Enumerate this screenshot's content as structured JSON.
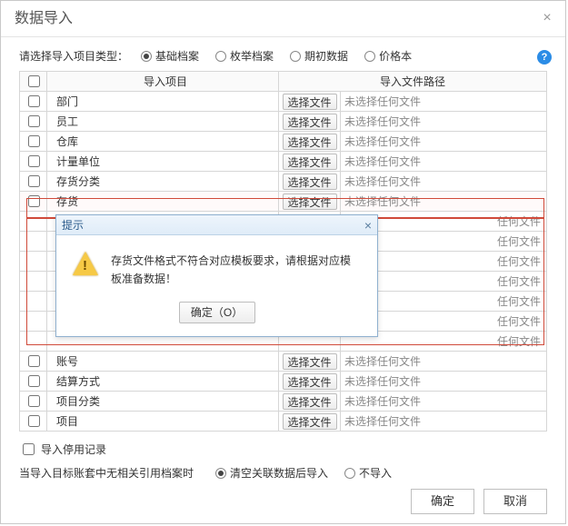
{
  "dialog": {
    "title": "数据导入",
    "type_label": "请选择导入项目类型：",
    "radios": [
      {
        "label": "基础档案",
        "checked": true
      },
      {
        "label": "枚举档案",
        "checked": false
      },
      {
        "label": "期初数据",
        "checked": false
      },
      {
        "label": "价格本",
        "checked": false
      }
    ],
    "table": {
      "head_item": "导入项目",
      "head_path": "导入文件路径",
      "file_btn": "选择文件",
      "no_file": "未选择任何文件",
      "short_file": "任何文件",
      "rows": [
        {
          "name": "部门",
          "path_kind": "full"
        },
        {
          "name": "员工",
          "path_kind": "full"
        },
        {
          "name": "仓库",
          "path_kind": "full"
        },
        {
          "name": "计量单位",
          "path_kind": "full"
        },
        {
          "name": "存货分类",
          "path_kind": "full"
        },
        {
          "name": "存货",
          "path_kind": "full",
          "highlight": true
        },
        {
          "name": "",
          "path_kind": "short"
        },
        {
          "name": "",
          "path_kind": "short"
        },
        {
          "name": "",
          "path_kind": "short"
        },
        {
          "name": "",
          "path_kind": "short"
        },
        {
          "name": "",
          "path_kind": "short"
        },
        {
          "name": "",
          "path_kind": "short"
        },
        {
          "name": "",
          "path_kind": "short"
        },
        {
          "name": "账号",
          "path_kind": "full"
        },
        {
          "name": "结算方式",
          "path_kind": "full"
        },
        {
          "name": "项目分类",
          "path_kind": "full"
        },
        {
          "name": "项目",
          "path_kind": "full"
        }
      ]
    },
    "stop_label": "导入停用记录",
    "ref_label": "当导入目标账套中无相关引用档案时",
    "ref_opts": [
      {
        "label": "清空关联数据后导入",
        "checked": true
      },
      {
        "label": "不导入",
        "checked": false
      }
    ],
    "footer": {
      "ok": "确定",
      "cancel": "取消"
    }
  },
  "alert": {
    "title": "提示",
    "message": "存货文件格式不符合对应模板要求，请根据对应模板准备数据！",
    "ok": "确定（O）"
  }
}
